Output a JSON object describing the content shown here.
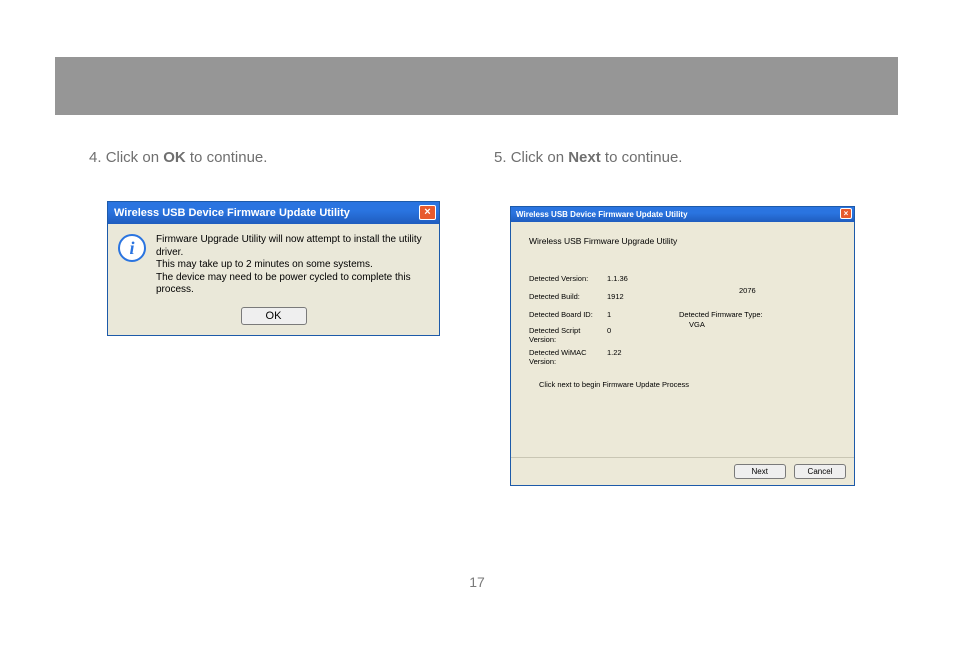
{
  "instructions": {
    "left": {
      "num": "4.",
      "pre": "Click on ",
      "bold": "OK",
      "post": " to continue."
    },
    "right": {
      "num": "5.",
      "pre": "Click on ",
      "bold": "Next",
      "post": " to continue."
    }
  },
  "dlg_ok": {
    "title": "Wireless USB Device Firmware Update Utility",
    "close_glyph": "×",
    "info_glyph": "i",
    "msg_line1": "Firmware Upgrade Utility will now attempt to install the utility driver.",
    "msg_line2": "This may take up to 2 minutes on some systems.",
    "msg_line3": "The device may need to be power cycled to complete this process.",
    "ok_label": "OK"
  },
  "dlg_update": {
    "title": "Wireless USB Device Firmware Update Utility",
    "close_glyph": "×",
    "heading": "Wireless USB Firmware Upgrade Utility",
    "fields": {
      "detected_version_label": "Detected Version:",
      "detected_version_value": "1.1.36",
      "detected_build_label": "Detected Build:",
      "detected_build_value": "1912",
      "extra_number": "2076",
      "detected_board_id_label": "Detected Board ID:",
      "detected_board_id_value": "1",
      "detected_firmware_type_label": "Detected Firmware Type:",
      "detected_firmware_type_value": "VGA",
      "detected_script_version_label": "Detected Script Version:",
      "detected_script_version_value": "0",
      "detected_wimac_version_label": "Detected WiMAC Version:",
      "detected_wimac_version_value": "1.22"
    },
    "hint": "Click next to begin Firmware Update Process",
    "next_label": "Next",
    "cancel_label": "Cancel"
  },
  "page_number": "17"
}
